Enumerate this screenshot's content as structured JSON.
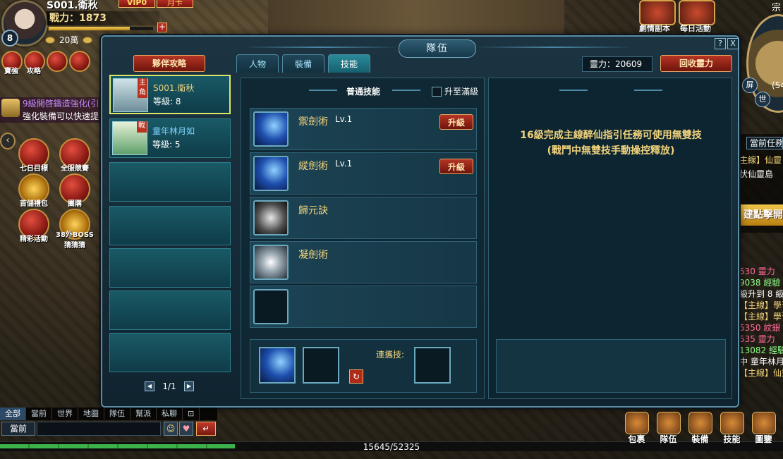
{
  "player": {
    "name": "S001.衛秋",
    "level": "8",
    "power": "戰力：1873",
    "vip": "VIP0",
    "month_card": "月卡",
    "money": "20萬",
    "exp_percent": 78
  },
  "quest_tip": {
    "line1": "9級開啓鑄造強化(引",
    "line2": "強化裝備可以快速提"
  },
  "side_icons": [
    "七日目標",
    "全服競賽",
    "首儲禮包",
    "團購",
    "精彩活動",
    "38外BOSS猜猜猜"
  ],
  "top_left_icons": [
    "寶強",
    "攻略"
  ],
  "top_right": {
    "items": [
      "劇情副本",
      "每日活動"
    ],
    "corner": "宗"
  },
  "minimap_buttons": [
    "屏",
    "世"
  ],
  "minimap_coord": "(54",
  "right_feed": {
    "header": "當前任務",
    "lines": [
      {
        "text": "主線】仙靈",
        "color": "#f1d37c"
      },
      {
        "text": "伏仙靈島",
        "color": "#ffffff"
      },
      {
        "text": "530 靈力",
        "color": "#ff6b9a"
      },
      {
        "text": "9038 經驗",
        "color": "#8fff8a"
      },
      {
        "text": "級升到 8 級",
        "color": "#ffffff"
      },
      {
        "text": "【主線】學習",
        "color": "#f1d37c"
      },
      {
        "text": "【主線】學習",
        "color": "#f1d37c"
      },
      {
        "text": "5350 紋銀",
        "color": "#ff6b9a"
      },
      {
        "text": "535 靈力",
        "color": "#ff6b9a"
      },
      {
        "text": "13082 經驗",
        "color": "#8fff8a"
      },
      {
        "text": "中 童年林月",
        "color": "#ffffff"
      },
      {
        "text": "【主線】仙靈",
        "color": "#f1d37c"
      }
    ],
    "banner": "建點擊開始"
  },
  "dialog": {
    "title": "隊伍",
    "help": "?",
    "close": "X",
    "strategy_button": "夥伴攻略",
    "tabs": [
      {
        "label": "人物",
        "active": false
      },
      {
        "label": "裝備",
        "active": false
      },
      {
        "label": "技能",
        "active": true
      }
    ],
    "spirit": "靈力：20609",
    "recycle_button": "回收靈力",
    "party": [
      {
        "tag": "主角",
        "name": "S001.衛秋",
        "level": "等級: 8",
        "name_color": "#f1d37c",
        "selected": true
      },
      {
        "tag": "戰",
        "name": "童年林月如",
        "level": "等級: 5",
        "name_color": "#7fd3ff",
        "selected": false
      }
    ],
    "pager": "1/1",
    "skills_header": "普通技能",
    "max_level_label": "升至滿級",
    "skills": [
      {
        "name": "禦劍術",
        "level": "Lv.1",
        "upgrade": "升級",
        "icon": "sword"
      },
      {
        "name": "縱劍術",
        "level": "Lv.1",
        "upgrade": "升級",
        "icon": "sword"
      },
      {
        "name": "歸元訣",
        "level": "",
        "upgrade": "",
        "icon": "white"
      },
      {
        "name": "凝劍術",
        "level": "",
        "upgrade": "",
        "icon": "burst"
      },
      {
        "name": "",
        "level": "",
        "upgrade": "",
        "icon": "empty"
      }
    ],
    "combo_label": "連攜技:",
    "info_line1": "16級完成主線醉仙指引任務可使用無雙技",
    "info_line2": "(戰鬥中無雙技手動操控釋放)"
  },
  "chat": {
    "tabs": [
      "全部",
      "當前",
      "世界",
      "地圖",
      "隊伍",
      "幫派",
      "私聊"
    ],
    "channel": "當前"
  },
  "exp": {
    "text": "15645/52325",
    "percent": 30
  },
  "bottom_menu": [
    "包裹",
    "隊伍",
    "裝備",
    "技能",
    "圖鑒"
  ],
  "colors": {
    "accent_gold": "#f1d37c",
    "panel_teal": "#195a66",
    "button_red": "#b53424"
  }
}
